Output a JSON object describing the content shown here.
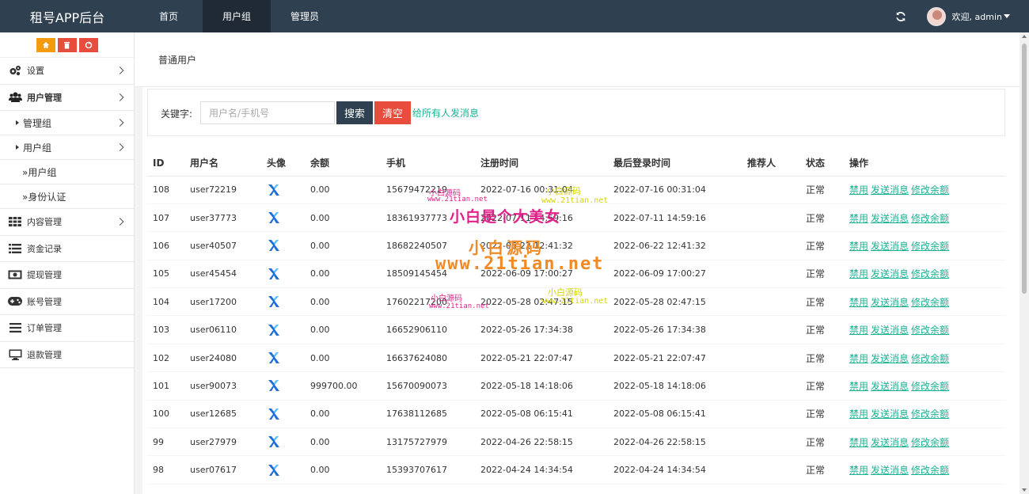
{
  "app": {
    "title": "租号APP后台"
  },
  "topnav": [
    {
      "label": "首页",
      "active": false
    },
    {
      "label": "用户组",
      "active": true
    },
    {
      "label": "管理员",
      "active": false
    }
  ],
  "user": {
    "welcome": "欢迎, admin"
  },
  "sidebar": {
    "tools": [
      {
        "icon": "home-icon"
      },
      {
        "icon": "trash-icon"
      },
      {
        "icon": "recycle-icon"
      }
    ],
    "items": [
      {
        "label": "设置",
        "icon": "gears-icon"
      },
      {
        "label": "用户管理",
        "icon": "users-icon"
      },
      {
        "label": "管理组"
      },
      {
        "label": "用户组"
      },
      {
        "label": "»用户组"
      },
      {
        "label": "»身份认证"
      },
      {
        "label": "内容管理",
        "icon": "grid-icon"
      },
      {
        "label": "资金记录",
        "icon": "list-icon"
      },
      {
        "label": "提现管理",
        "icon": "money-icon"
      },
      {
        "label": "账号管理",
        "icon": "gamepad-icon"
      },
      {
        "label": "订单管理",
        "icon": "bars-icon"
      },
      {
        "label": "退款管理",
        "icon": "monitor-icon"
      }
    ]
  },
  "page": {
    "title": "普通用户"
  },
  "search": {
    "label": "关键字:",
    "placeholder": "用户名/手机号",
    "search_button": "搜索",
    "clear_button": "清空",
    "message_all": "给所有人发消息"
  },
  "table": {
    "columns": [
      "ID",
      "用户名",
      "头像",
      "余额",
      "手机",
      "注册时间",
      "最后登录时间",
      "推荐人",
      "状态",
      "操作"
    ],
    "actions": [
      "禁用",
      "发送消息",
      "修改余额"
    ],
    "rows": [
      {
        "id": "108",
        "username": "user72219",
        "balance": "0.00",
        "phone": "15679472219",
        "reg": "2022-07-16 00:31:04",
        "last": "2022-07-16 00:31:04",
        "ref": "",
        "status": "正常"
      },
      {
        "id": "107",
        "username": "user37773",
        "balance": "0.00",
        "phone": "18361937773",
        "reg": "2022-07-11 14:59:16",
        "last": "2022-07-11 14:59:16",
        "ref": "",
        "status": "正常"
      },
      {
        "id": "106",
        "username": "user40507",
        "balance": "0.00",
        "phone": "18682240507",
        "reg": "2022-06-22 12:41:32",
        "last": "2022-06-22 12:41:32",
        "ref": "",
        "status": "正常"
      },
      {
        "id": "105",
        "username": "user45454",
        "balance": "0.00",
        "phone": "18509145454",
        "reg": "2022-06-09 17:00:27",
        "last": "2022-06-09 17:00:27",
        "ref": "",
        "status": "正常"
      },
      {
        "id": "104",
        "username": "user17200",
        "balance": "0.00",
        "phone": "17602217200",
        "reg": "2022-05-28 02:47:15",
        "last": "2022-05-28 02:47:15",
        "ref": "",
        "status": "正常"
      },
      {
        "id": "103",
        "username": "user06110",
        "balance": "0.00",
        "phone": "16652906110",
        "reg": "2022-05-26 17:34:38",
        "last": "2022-05-26 17:34:38",
        "ref": "",
        "status": "正常"
      },
      {
        "id": "102",
        "username": "user24080",
        "balance": "0.00",
        "phone": "16637624080",
        "reg": "2022-05-21 22:07:47",
        "last": "2022-05-21 22:07:47",
        "ref": "",
        "status": "正常"
      },
      {
        "id": "101",
        "username": "user90073",
        "balance": "999700.00",
        "phone": "15670090073",
        "reg": "2022-05-18 14:18:06",
        "last": "2022-05-18 14:18:06",
        "ref": "",
        "status": "正常"
      },
      {
        "id": "100",
        "username": "user12685",
        "balance": "0.00",
        "phone": "17638112685",
        "reg": "2022-05-08 06:15:41",
        "last": "2022-05-08 06:15:41",
        "ref": "",
        "status": "正常"
      },
      {
        "id": "99",
        "username": "user27979",
        "balance": "0.00",
        "phone": "13175727979",
        "reg": "2022-04-26 22:58:15",
        "last": "2022-04-26 22:58:15",
        "ref": "",
        "status": "正常"
      },
      {
        "id": "98",
        "username": "user07617",
        "balance": "0.00",
        "phone": "15393707617",
        "reg": "2022-04-24 14:34:54",
        "last": "2022-04-24 14:34:54",
        "ref": "",
        "status": "正常"
      }
    ]
  },
  "watermarks": [
    {
      "text": "小白是个大美女",
      "color": "#e0218a"
    },
    {
      "text": "小白源码",
      "color": "#f08a24"
    },
    {
      "text": "www.21tian.net",
      "color": "#f08a24"
    },
    {
      "text": "小白源码",
      "color": "#e0218a"
    },
    {
      "text": "www.21tian.net",
      "color": "#e0218a"
    },
    {
      "text": "小白源码",
      "color": "#d4d400"
    },
    {
      "text": "www.21tian.net",
      "color": "#d4d400"
    }
  ]
}
